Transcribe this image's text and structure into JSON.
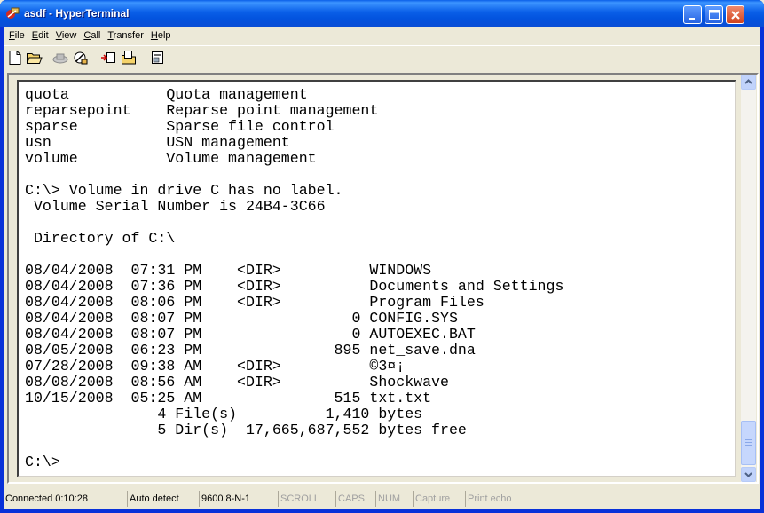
{
  "window": {
    "title": "asdf - HyperTerminal"
  },
  "menu": [
    {
      "label": "File",
      "mnemonic": "F",
      "rest": "ile"
    },
    {
      "label": "Edit",
      "mnemonic": "E",
      "rest": "dit"
    },
    {
      "label": "View",
      "mnemonic": "V",
      "rest": "iew"
    },
    {
      "label": "Call",
      "mnemonic": "C",
      "rest": "all"
    },
    {
      "label": "Transfer",
      "mnemonic": "T",
      "rest": "ransfer"
    },
    {
      "label": "Help",
      "mnemonic": "H",
      "rest": "elp"
    }
  ],
  "toolbar": {
    "icons": [
      "new-icon",
      "open-icon",
      "call-icon",
      "disconnect-icon",
      "send-icon",
      "receive-icon",
      "properties-icon"
    ]
  },
  "terminal": {
    "lines": [
      "quota           Quota management",
      "reparsepoint    Reparse point management",
      "sparse          Sparse file control",
      "usn             USN management",
      "volume          Volume management",
      "",
      "C:\\> Volume in drive C has no label.",
      " Volume Serial Number is 24B4-3C66",
      "",
      " Directory of C:\\",
      "",
      "08/04/2008  07:31 PM    <DIR>          WINDOWS",
      "08/04/2008  07:36 PM    <DIR>          Documents and Settings",
      "08/04/2008  08:06 PM    <DIR>          Program Files",
      "08/04/2008  08:07 PM                 0 CONFIG.SYS",
      "08/04/2008  08:07 PM                 0 AUTOEXEC.BAT",
      "08/05/2008  06:23 PM               895 net_save.dna",
      "07/28/2008  09:38 AM    <DIR>          ©3¤¡",
      "08/08/2008  08:56 AM    <DIR>          Shockwave",
      "10/15/2008  05:25 AM               515 txt.txt",
      "               4 File(s)          1,410 bytes",
      "               5 Dir(s)  17,665,687,552 bytes free",
      "",
      "C:\\>"
    ]
  },
  "status": {
    "connected": "Connected 0:10:28",
    "detect": "Auto detect",
    "settings": "9600 8-N-1",
    "scroll": "SCROLL",
    "caps": "CAPS",
    "num": "NUM",
    "capture": "Capture",
    "print_echo": "Print echo"
  },
  "colors": {
    "titlebar": "#0a5fe8",
    "window_bg": "#ece9d8",
    "terminal_bg": "#ffffff"
  }
}
